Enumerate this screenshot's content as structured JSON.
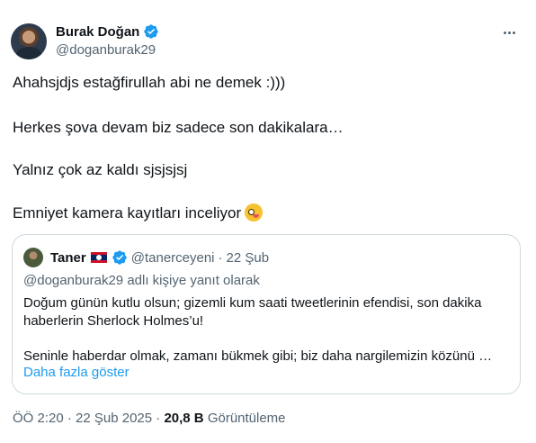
{
  "author": {
    "display_name": "Burak Doğan",
    "handle": "@doganburak29"
  },
  "tweet": {
    "lines": [
      "Ahahsjdjs estağfirullah abi ne demek :)))",
      "Herkes şova devam biz sadece son dakikalara…",
      "Yalnız çok az kaldı sjsjsjsj",
      "Emniyet kamera kayıtları inceliyor"
    ],
    "emoji": "zany-face-emoji"
  },
  "quoted": {
    "display_name": "Taner",
    "handle": "@tanerceyeni",
    "separator": "·",
    "date": "22 Şub",
    "reply_context": "@doganburak29 adlı kişiye yanıt olarak",
    "text_lines": [
      "Doğum günün kutlu olsun; gizemli kum saati tweetlerinin efendisi, son dakika",
      "haberlerin Sherlock Holmes’u!",
      "Seninle haberdar olmak, zamanı bükmek gibi; biz daha nargilemizin közünü …"
    ],
    "show_more": "Daha fazla göster"
  },
  "meta": {
    "time": "ÖÖ 2:20 · 22 Şub 2025 · ",
    "views_count": "20,8 B",
    "views_label": "Görüntüleme"
  },
  "colors": {
    "verified": "#1d9bf0",
    "link": "#1d9bf0",
    "secondary_text": "#536471"
  }
}
